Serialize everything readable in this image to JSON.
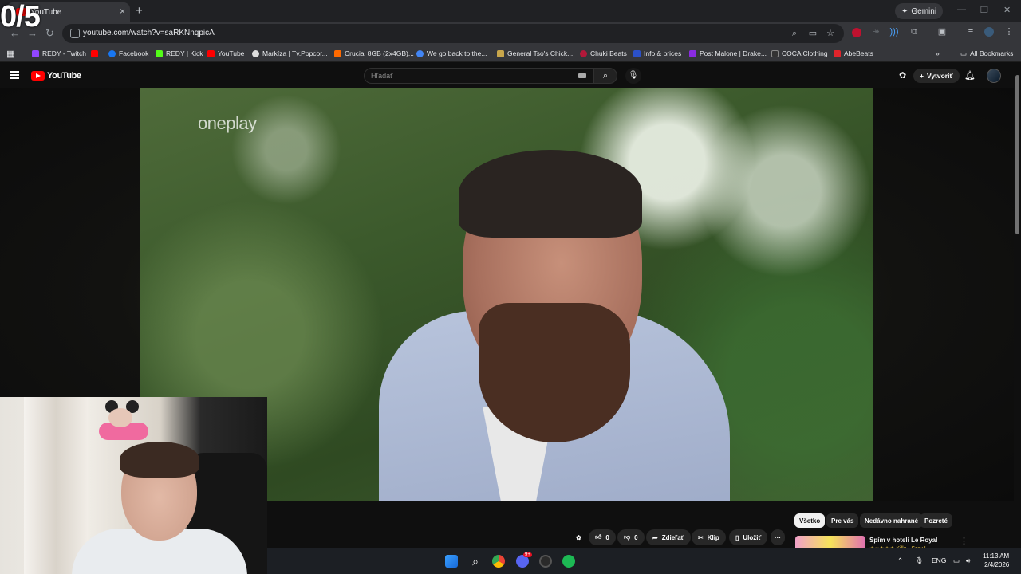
{
  "overlay": {
    "counter": "0/5"
  },
  "browser": {
    "tab_title": "YouTube",
    "tab_close": "×",
    "new_tab": "+",
    "gemini_label": "Gemini",
    "url": "youtube.com/watch?v=saRKNnqpicA",
    "all_bookmarks": "All Bookmarks",
    "bookmarks": [
      {
        "label": "REDY - Twitch",
        "color": "#9146ff"
      },
      {
        "label": "",
        "color": "#ff0000"
      },
      {
        "label": "Facebook",
        "color": "#1877f2"
      },
      {
        "label": "REDY | Kick",
        "color": "#53fc18"
      },
      {
        "label": "YouTube",
        "color": "#ff0000"
      },
      {
        "label": "Markíza | Tv.Popcor...",
        "color": "#dddddd"
      },
      {
        "label": "Crucial 8GB (2x4GB)...",
        "color": "#ff6a00"
      },
      {
        "label": "We go back to the...",
        "color": "#4285f4"
      },
      {
        "label": "General Tso's Chick...",
        "color": "#c8a64b"
      },
      {
        "label": "Chuki Beats",
        "color": "#b2183a"
      },
      {
        "label": "Info & prices",
        "color": "#2b50c7"
      },
      {
        "label": "Post Malone | Drake...",
        "color": "#8a2be2"
      },
      {
        "label": "COCA Clothing",
        "color": "#333333"
      },
      {
        "label": "AbeBeats",
        "color": "#e0242b"
      }
    ]
  },
  "youtube": {
    "logo_text": "YouTube",
    "search_placeholder": "Hľadať",
    "create_label": "Vytvoriť",
    "video": {
      "watermark": "oneplay"
    },
    "actions": {
      "like_count": "0",
      "dislike_count": "0",
      "share_label": "Zdieľať",
      "clip_label": "Klip",
      "save_label": "Uložiť",
      "more_label": "···"
    },
    "chips": [
      "Všetko",
      "Pre vás",
      "Nedávno nahrané",
      "Pozreté"
    ],
    "recommendation": {
      "title": "Spím v hoteli Le Royal",
      "stars": "★★★★★ Kille I Serv I"
    }
  },
  "taskbar": {
    "language": "ENG",
    "time": "11:13 AM",
    "date": "2/4/2026",
    "discord_badge": "9+"
  }
}
